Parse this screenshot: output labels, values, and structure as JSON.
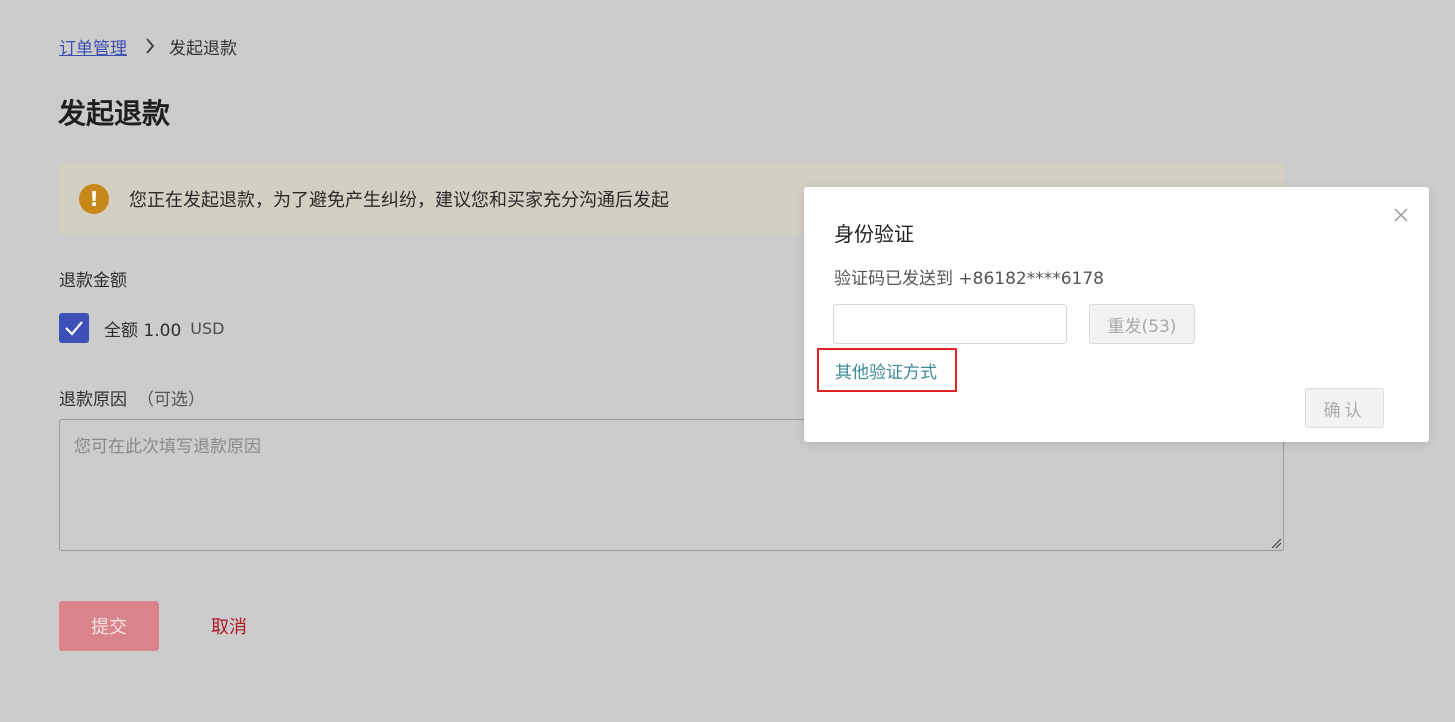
{
  "breadcrumb": {
    "parent": "订单管理",
    "current": "发起退款"
  },
  "page": {
    "title": "发起退款"
  },
  "alert": {
    "icon": "warning-icon",
    "color": "#c8871a",
    "text": "您正在发起退款，为了避免产生纠纷，建议您和买家充分沟通后发起"
  },
  "refund_amount": {
    "label": "退款金额",
    "checkbox_checked": true,
    "option_label": "全额 1.00",
    "currency": "USD"
  },
  "refund_reason": {
    "label": "退款原因",
    "optional": "（可选）",
    "placeholder": "您可在此次填写退款原因",
    "value": ""
  },
  "actions": {
    "submit_label": "提交",
    "cancel_label": "取消",
    "submit_color": "#d9848b",
    "cancel_color": "#b1182a"
  },
  "dialog": {
    "title": "身份验证",
    "message": "验证码已发送到 +86182****6178",
    "code_length": 6,
    "resend_label": "重发(53)",
    "other_method_label": "其他验证方式",
    "confirm_label": "确认",
    "highlight_color": "#e02424"
  }
}
